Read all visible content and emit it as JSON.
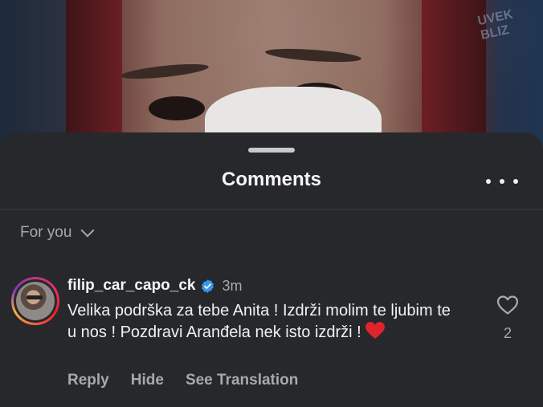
{
  "photo": {
    "sign_text": "UVEK BLIZ"
  },
  "sheet": {
    "title": "Comments",
    "more_icon": "more-horizontal-icon"
  },
  "filter": {
    "label": "For you",
    "icon": "chevron-down-icon"
  },
  "comment": {
    "username": "filip_car_capo_ck",
    "verified_icon": "verified-badge-icon",
    "time": "3m",
    "text": "Velika podrška za tebe Anita ! Izdrži molim te ljubim te u nos ! Pozdravi Aranđela nek isto izdrži !",
    "emoji": "red-heart",
    "like_count": "2",
    "actions": {
      "reply": "Reply",
      "hide": "Hide",
      "translate": "See Translation"
    }
  },
  "colors": {
    "sheet_bg": "#26282c",
    "text_primary": "#f5f5f5",
    "text_secondary": "#a8a9ad",
    "verified_blue": "#3897f0",
    "heart_red": "#e0242f"
  }
}
